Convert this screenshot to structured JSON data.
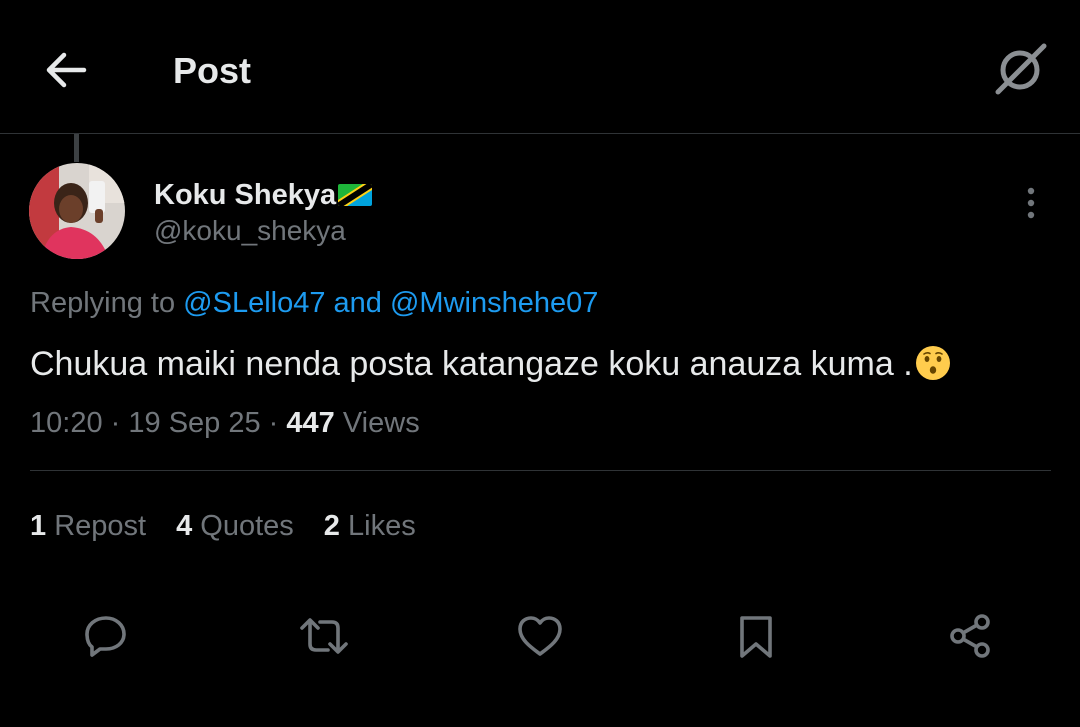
{
  "header": {
    "title": "Post",
    "back_icon": "arrow-left-icon",
    "grok_icon": "grok-icon"
  },
  "post": {
    "author": {
      "display_name": "Koku Shekya",
      "handle": "@koku_shekya",
      "flag_icon": "tanzania-flag-icon"
    },
    "replying_prefix": "Replying to",
    "replying_mention_1": "@SLello47",
    "replying_and": "and",
    "replying_mention_2": "@Mwinshehe07",
    "text": "Chukua maiki nenda posta katangaze koku anauza kuma .",
    "text_emoji": "kissing-face-emoji",
    "time": "10:20",
    "sep": "·",
    "date": "19 Sep 25",
    "views_count": "447",
    "views_label": "Views"
  },
  "stats": {
    "reposts_count": "1",
    "reposts_label": "Repost",
    "quotes_count": "4",
    "quotes_label": "Quotes",
    "likes_count": "2",
    "likes_label": "Likes"
  },
  "actions": [
    "reply-icon",
    "repost-icon",
    "like-icon",
    "bookmark-icon",
    "share-icon"
  ],
  "colors": {
    "background": "#000000",
    "text_primary": "#e7e9ea",
    "text_secondary": "#71767b",
    "accent": "#1d9bf0",
    "divider": "#2f3336"
  }
}
